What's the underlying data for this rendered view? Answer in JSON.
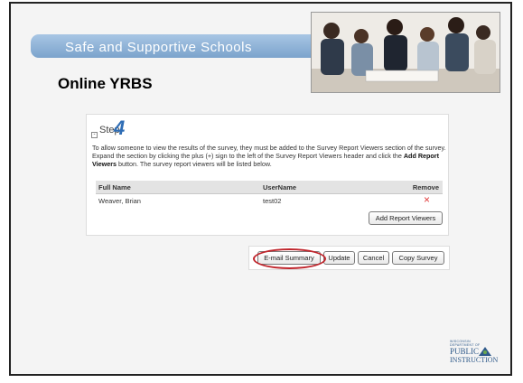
{
  "slide": {
    "banner_title": "Safe and Supportive Schools",
    "subtitle": "Online YRBS"
  },
  "step": {
    "label": "Step",
    "number": "4",
    "expander_symbol": "-",
    "instructions_part1": "To allow someone to view the results of the survey, they must be added to the Survey Report Viewers section of the survey. Expand the section by clicking the plus (+) sign to the left of the Survey Report Viewers header and click the ",
    "instructions_bold": "Add Report Viewers",
    "instructions_part2": " button. The survey report viewers will be listed below."
  },
  "table": {
    "headers": [
      "Full Name",
      "UserName",
      "Remove"
    ],
    "rows": [
      {
        "full_name": "Weaver, Brian",
        "username": "test02",
        "remove": "×"
      }
    ]
  },
  "buttons": {
    "add_report_viewers": "Add Report Viewers",
    "email_summary": "E-mail Summary",
    "update": "Update",
    "cancel": "Cancel",
    "copy_survey": "Copy Survey"
  },
  "logo": {
    "small_text": "WISCONSIN DEPARTMENT OF",
    "line1": "PUBLIC",
    "line2": "INSTRUCTION"
  },
  "colors": {
    "banner": "#8fb3d9",
    "step_number": "#2f6db5",
    "highlight_oval": "#c0262d",
    "remove_icon": "#e03a3a"
  }
}
